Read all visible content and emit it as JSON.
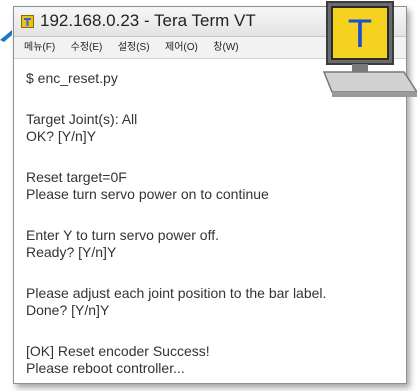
{
  "window": {
    "title": "192.168.0.23 - Tera Term VT"
  },
  "menu": [
    {
      "label": "메뉴(F)"
    },
    {
      "label": "수정(E)"
    },
    {
      "label": "설정(S)"
    },
    {
      "label": "제어(O)"
    },
    {
      "label": "창(W)"
    }
  ],
  "terminal": {
    "lines": [
      "$ enc_reset.py",
      "Target Joint(s): All",
      "OK? [Y/n]Y",
      "Reset target=0F",
      "Please turn servo power on to continue",
      "Enter Y to turn servo power off.",
      "Ready? [Y/n]Y",
      "Please adjust each joint position to the bar label.",
      "Done? [Y/n]Y",
      "[OK] Reset encoder Success!",
      "Please reboot controller..."
    ]
  },
  "logo": {
    "letter": "T",
    "icon": "computer-icon"
  },
  "colors": {
    "logo_screen": "#f5d21f",
    "logo_letter": "#1f4fd1",
    "arrow": "#1f78c8"
  }
}
